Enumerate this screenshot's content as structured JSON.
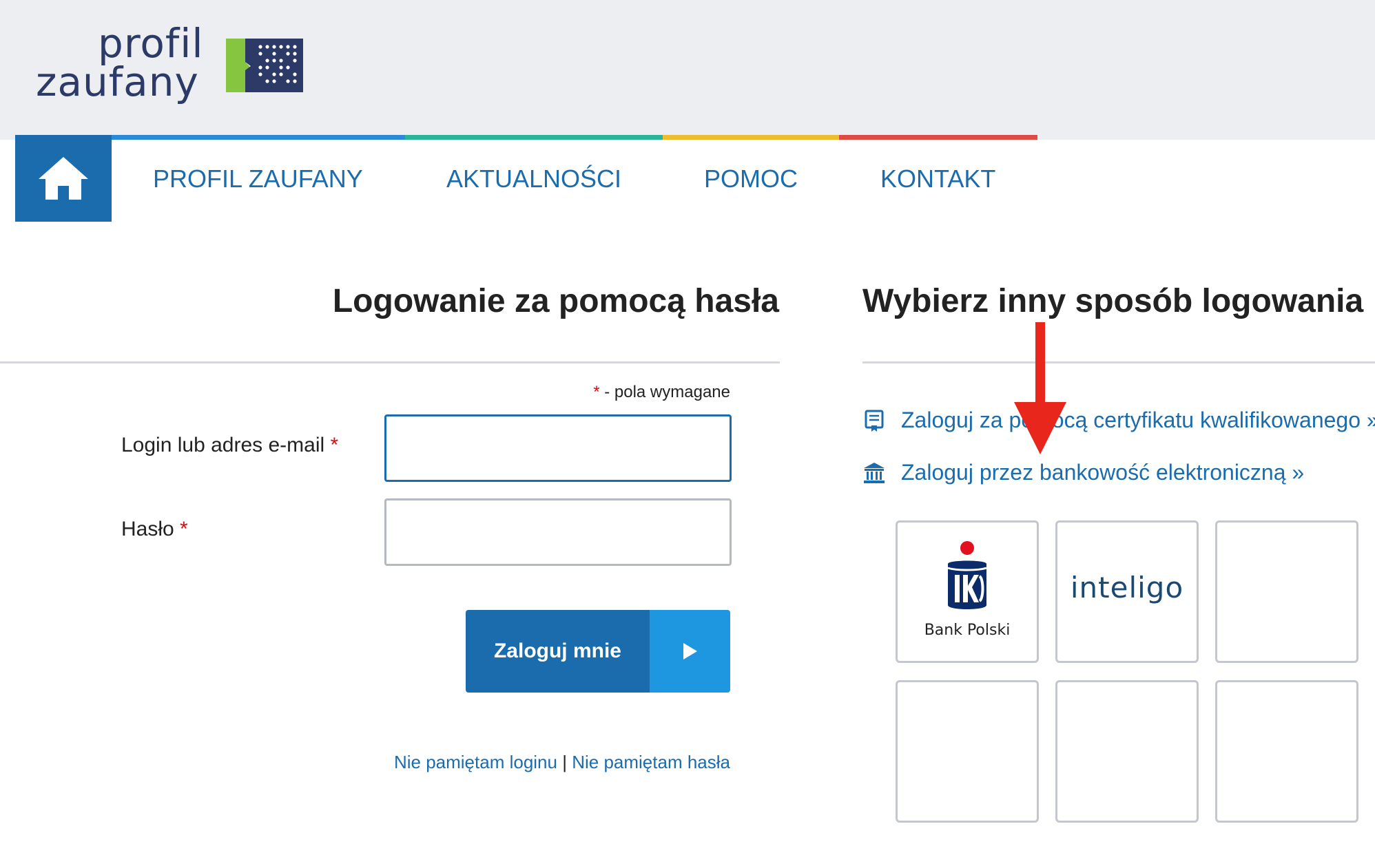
{
  "logo": {
    "line1": "profil",
    "line2": "zaufany"
  },
  "nav": {
    "items": [
      {
        "label": "PROFIL ZAUFANY"
      },
      {
        "label": "AKTUALNOŚCI"
      },
      {
        "label": "POMOC"
      },
      {
        "label": "KONTAKT"
      }
    ],
    "colors": {
      "blue": "#2a8ad8",
      "teal": "#2ab59a",
      "yellow": "#ecbd2f",
      "red": "#df4b43",
      "home": "#1b6cad"
    }
  },
  "login": {
    "title": "Logowanie za pomocą hasła",
    "required_star": "*",
    "required_note": " - pola wymagane",
    "login_label": "Login lub adres e-mail",
    "password_label": "Hasło",
    "login_value": "",
    "password_value": "",
    "submit_label": "Zaloguj mnie",
    "forgot_login": "Nie pamiętam loginu",
    "forgot_separator": "|",
    "forgot_password": "Nie pamiętam hasła"
  },
  "alternatives": {
    "title": "Wybierz inny sposób logowania",
    "certificate_link": "Zaloguj za pomocą certyfikatu kwalifikowanego »",
    "bank_link": "Zaloguj przez bankowość elektroniczną »",
    "banks": [
      {
        "name": "Bank Polski",
        "logo": "pko-logo"
      },
      {
        "name": "inteligo",
        "logo": "inteligo-logo"
      },
      {
        "name": "",
        "logo": ""
      },
      {
        "name": "",
        "logo": ""
      },
      {
        "name": "",
        "logo": ""
      },
      {
        "name": "",
        "logo": ""
      }
    ]
  },
  "annotation": {
    "color": "#e8261c",
    "icon": "red-arrow-icon"
  }
}
